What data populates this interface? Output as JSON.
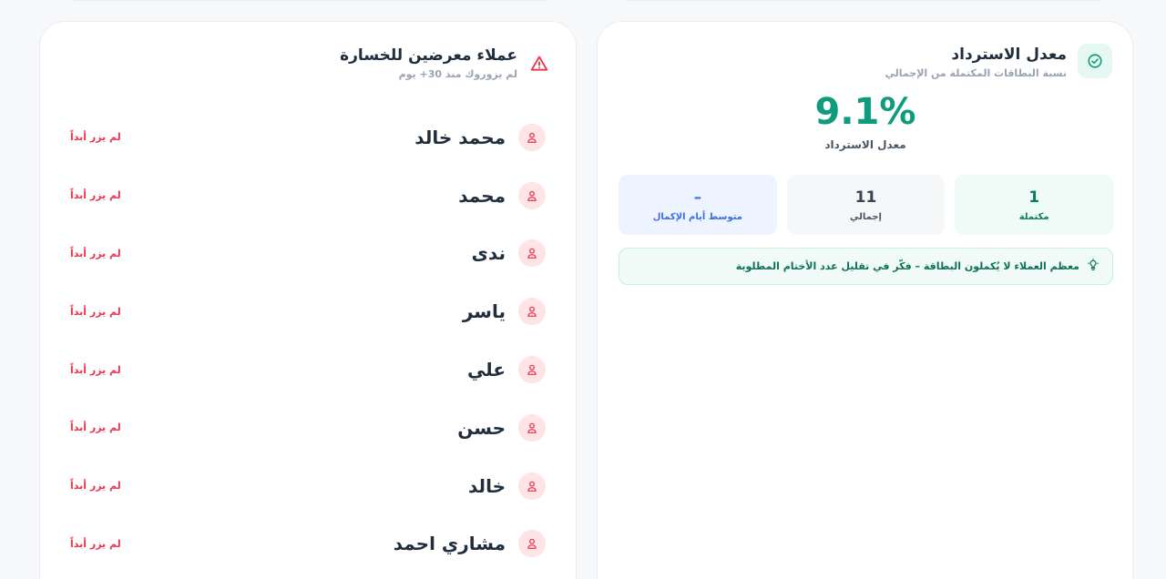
{
  "at_risk": {
    "title": "عملاء معرضين للخسارة",
    "subtitle": "لم يزوروك منذ 30+ يوم",
    "icon": "warning-triangle-icon",
    "customers": [
      {
        "name": "محمد خالد",
        "status": "لم يزر أبداً"
      },
      {
        "name": "محمد",
        "status": "لم يزر أبداً"
      },
      {
        "name": "ندى",
        "status": "لم يزر أبداً"
      },
      {
        "name": "ياسر",
        "status": "لم يزر أبداً"
      },
      {
        "name": "علي",
        "status": "لم يزر أبداً"
      },
      {
        "name": "حسن",
        "status": "لم يزر أبداً"
      },
      {
        "name": "خالد",
        "status": "لم يزر أبداً"
      },
      {
        "name": "مشاري احمد",
        "status": "لم يزر أبداً"
      }
    ]
  },
  "redemption": {
    "title": "معدل الاسترداد",
    "subtitle": "نسبة البطاقات المكتملة من الإجمالي",
    "icon": "check-circle-icon",
    "rate": "9.1%",
    "rate_label": "معدل الاسترداد",
    "stats": {
      "completed": {
        "value": "1",
        "label": "مكتملة"
      },
      "total": {
        "value": "11",
        "label": "إجمالي"
      },
      "avg_days": {
        "value": "–",
        "label": "متوسط أيام الإكمال"
      }
    },
    "tip": "معظم العملاء لا يُكملون البطاقة – فكّر في تقليل عدد الأختام المطلوبة",
    "tip_icon": "lightbulb-icon"
  },
  "colors": {
    "accent_green": "#0f9b7e",
    "danger_red": "#e8364d",
    "info_blue": "#3b6fe0"
  }
}
